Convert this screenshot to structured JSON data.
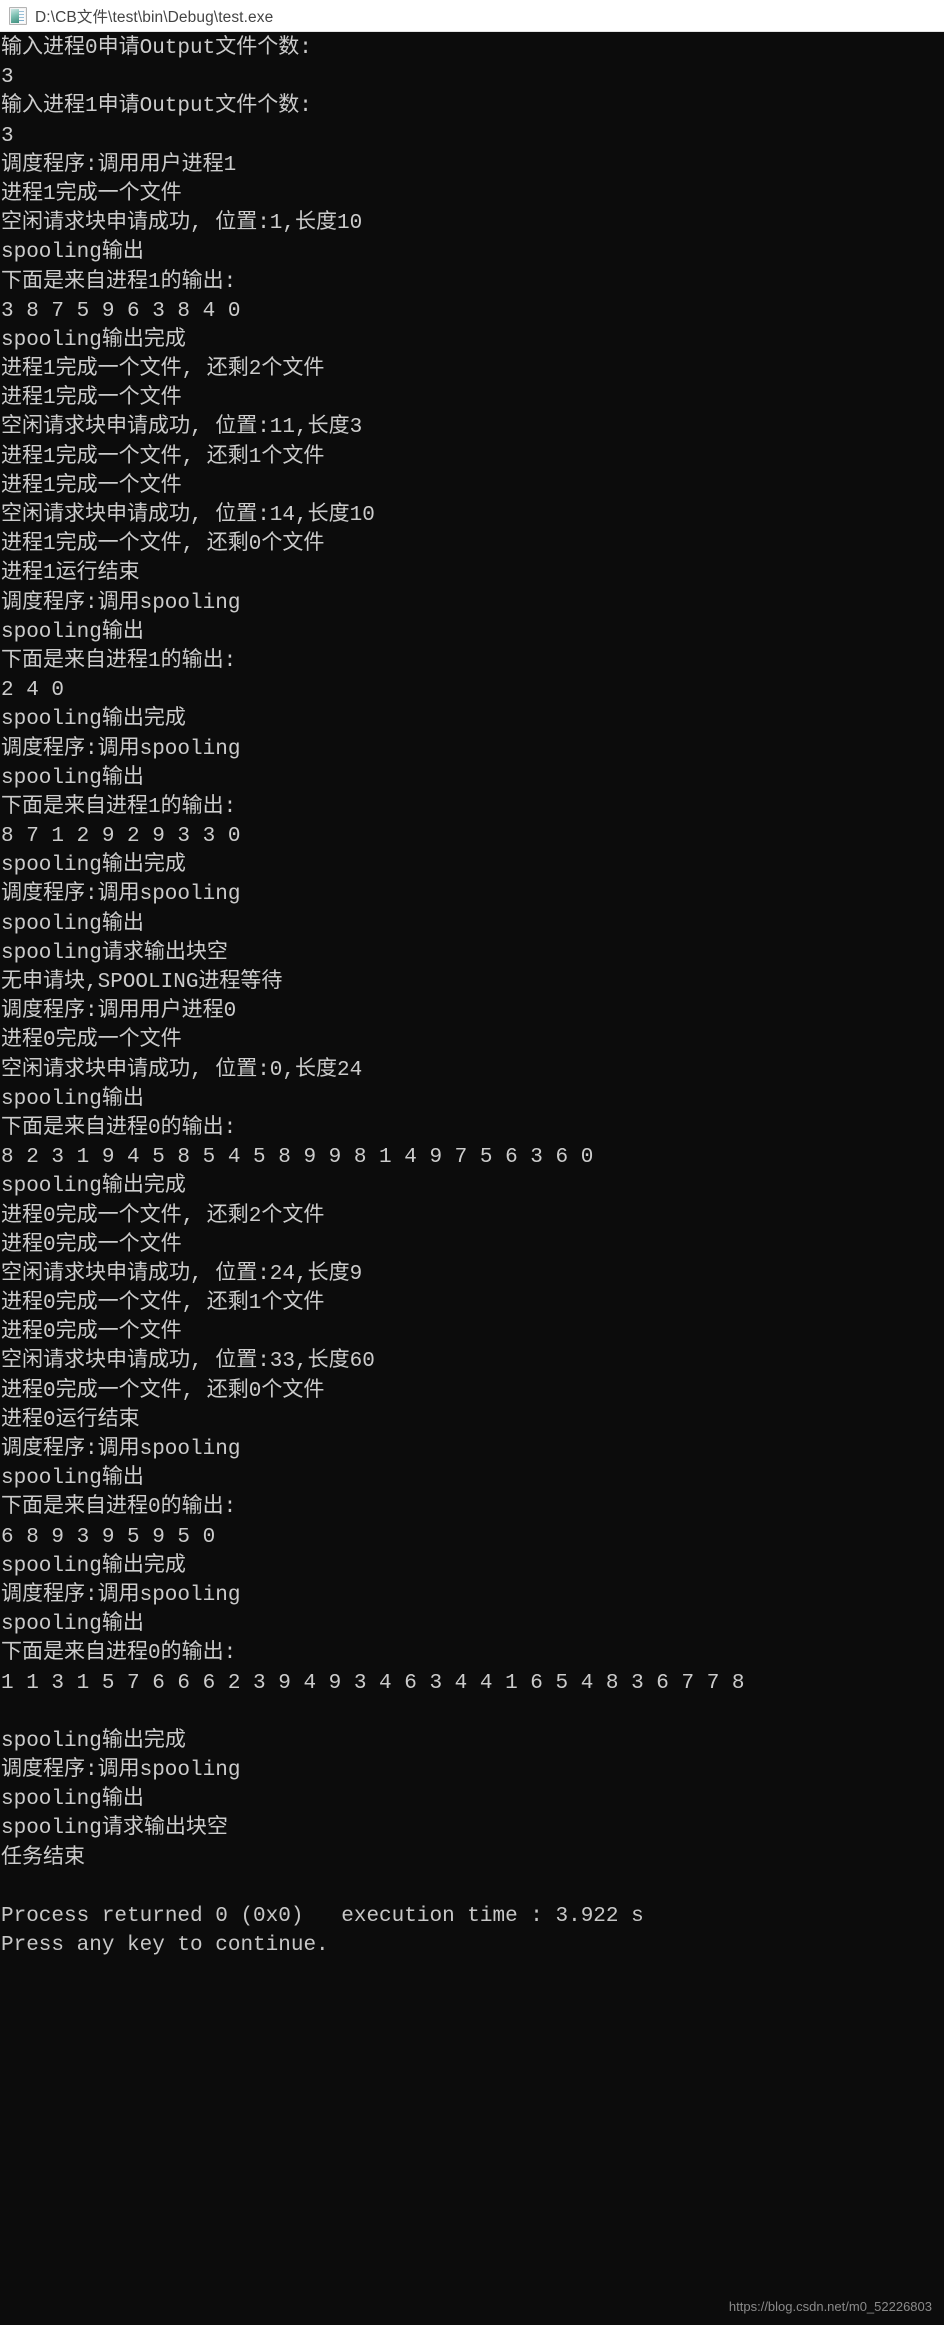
{
  "window": {
    "title": "D:\\CB文件\\test\\bin\\Debug\\test.exe",
    "icon": "console-app-icon"
  },
  "console": {
    "background_color": "#0c0c0c",
    "text_color": "#cccccc",
    "lines": [
      "输入进程0申请Output文件个数:",
      "3",
      "输入进程1申请Output文件个数:",
      "3",
      "调度程序:调用用户进程1",
      "进程1完成一个文件",
      "空闲请求块申请成功, 位置:1,长度10",
      "spooling输出",
      "下面是来自进程1的输出:",
      "3 8 7 5 9 6 3 8 4 0 ",
      "spooling输出完成",
      "进程1完成一个文件, 还剩2个文件",
      "进程1完成一个文件",
      "空闲请求块申请成功, 位置:11,长度3",
      "进程1完成一个文件, 还剩1个文件",
      "进程1完成一个文件",
      "空闲请求块申请成功, 位置:14,长度10",
      "进程1完成一个文件, 还剩0个文件",
      "进程1运行结束",
      "调度程序:调用spooling",
      "spooling输出",
      "下面是来自进程1的输出:",
      "2 4 0 ",
      "spooling输出完成",
      "调度程序:调用spooling",
      "spooling输出",
      "下面是来自进程1的输出:",
      "8 7 1 2 9 2 9 3 3 0 ",
      "spooling输出完成",
      "调度程序:调用spooling",
      "spooling输出",
      "spooling请求输出块空",
      "无申请块,SPOOLING进程等待",
      "调度程序:调用用户进程0",
      "进程0完成一个文件",
      "空闲请求块申请成功, 位置:0,长度24",
      "spooling输出",
      "下面是来自进程0的输出:",
      "8 2 3 1 9 4 5 8 5 4 5 8 9 9 8 1 4 9 7 5 6 3 6 0 ",
      "spooling输出完成",
      "进程0完成一个文件, 还剩2个文件",
      "进程0完成一个文件",
      "空闲请求块申请成功, 位置:24,长度9",
      "进程0完成一个文件, 还剩1个文件",
      "进程0完成一个文件",
      "空闲请求块申请成功, 位置:33,长度60",
      "进程0完成一个文件, 还剩0个文件",
      "进程0运行结束",
      "调度程序:调用spooling",
      "spooling输出",
      "下面是来自进程0的输出:",
      "6 8 9 3 9 5 9 5 0 ",
      "spooling输出完成",
      "调度程序:调用spooling",
      "spooling输出",
      "下面是来自进程0的输出:",
      "1 1 3 1 5 7 6 6 6 2 3 9 4 9 3 4 6 3 4 4 1 6 5 4 8 3 6 7 7 8",
      " ",
      "spooling输出完成",
      "调度程序:调用spooling",
      "spooling输出",
      "spooling请求输出块空",
      "任务结束"
    ],
    "tail_lines": [
      "Process returned 0 (0x0)   execution time : 3.922 s",
      "Press any key to continue."
    ]
  },
  "watermark": {
    "text": "https://blog.csdn.net/m0_52226803"
  }
}
